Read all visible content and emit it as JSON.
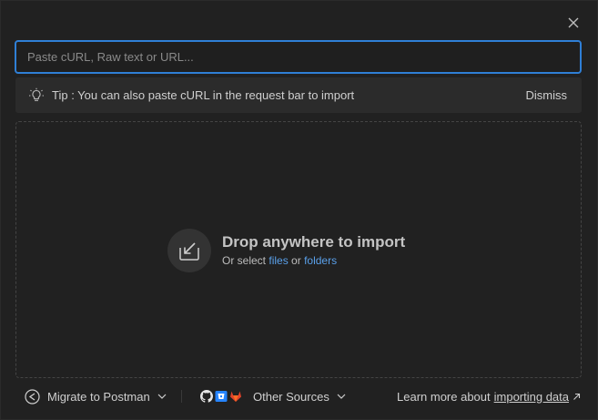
{
  "search": {
    "placeholder": "Paste cURL, Raw text or URL...",
    "value": ""
  },
  "tip": {
    "text": "Tip : You can also paste cURL in the request bar to import",
    "dismiss_label": "Dismiss"
  },
  "drop_zone": {
    "title": "Drop anywhere to import",
    "sub_prefix": "Or select",
    "files_link": "files",
    "or_text": "or",
    "folders_link": "folders"
  },
  "footer": {
    "migrate_label": "Migrate to Postman",
    "other_sources_label": "Other Sources",
    "learn_prefix": "Learn more about",
    "learn_link": "importing data"
  },
  "colors": {
    "accent": "#2f7fd6",
    "link": "#5aa0ea",
    "gitlab": "#e2432a",
    "bitbucket": "#2684ff"
  }
}
